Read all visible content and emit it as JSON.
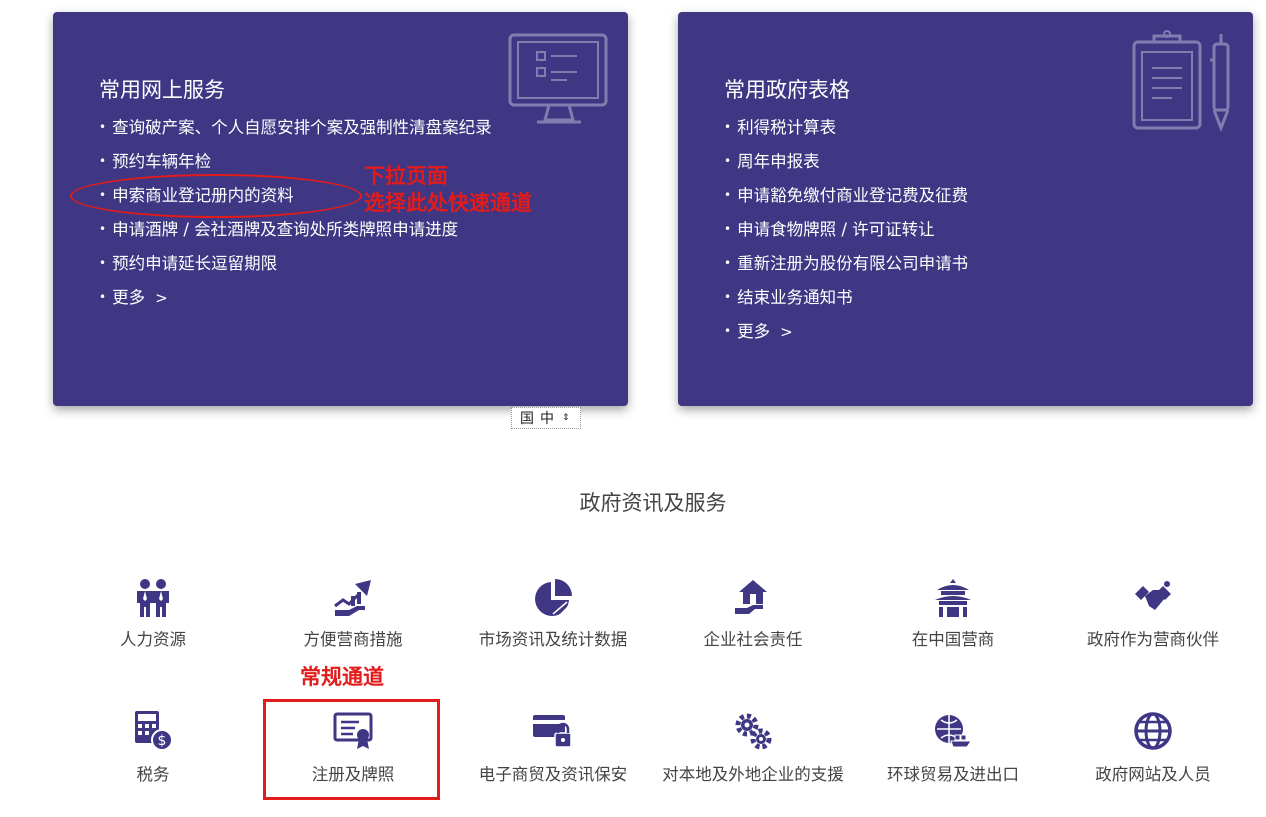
{
  "online_services": {
    "title": "常用网上服务",
    "items": [
      "查询破产案、个人自愿安排个案及强制性清盘案纪录",
      "预约车辆年检",
      "申索商业登记册内的资料",
      "申请酒牌 / 会社酒牌及查询处所类牌照申请进度",
      "预约申请延长逗留期限",
      "更多"
    ],
    "more_arrow": ">"
  },
  "gov_forms": {
    "title": "常用政府表格",
    "items": [
      "利得税计算表",
      "周年申报表",
      "申请豁免缴付商业登记费及征费",
      "申请食物牌照 / 许可证转让",
      "重新注册为股份有限公司申请书",
      "结束业务通知书",
      "更多"
    ],
    "more_arrow": ">"
  },
  "annotations": {
    "pulldown_line1": "下拉页面",
    "pulldown_line2": "选择此处快速通道",
    "regular_channel": "常规通道",
    "color": "#e21b1b"
  },
  "language_select": {
    "value": "中",
    "icon": "国"
  },
  "section": {
    "title": "政府资讯及服务",
    "row1": [
      {
        "label": "人力资源",
        "icon": "people-icon"
      },
      {
        "label": "方便营商措施",
        "icon": "growth-hand-icon"
      },
      {
        "label": "市场资讯及统计数据",
        "icon": "pie-chart-icon"
      },
      {
        "label": "企业社会责任",
        "icon": "house-hand-icon"
      },
      {
        "label": "在中国营商",
        "icon": "temple-icon"
      },
      {
        "label": "政府作为营商伙伴",
        "icon": "handshake-icon"
      }
    ],
    "row2": [
      {
        "label": "税务",
        "icon": "calculator-dollar-icon"
      },
      {
        "label": "注册及牌照",
        "icon": "certificate-icon"
      },
      {
        "label": "电子商贸及资讯保安",
        "icon": "card-lock-icon"
      },
      {
        "label": "对本地及外地企业的支援",
        "icon": "gears-icon"
      },
      {
        "label": "环球贸易及进出口",
        "icon": "globe-ship-icon"
      },
      {
        "label": "政府网站及人员",
        "icon": "globe-icon"
      }
    ]
  },
  "colors": {
    "card_bg": "#3f3684",
    "icon_purple": "#3f3684"
  }
}
